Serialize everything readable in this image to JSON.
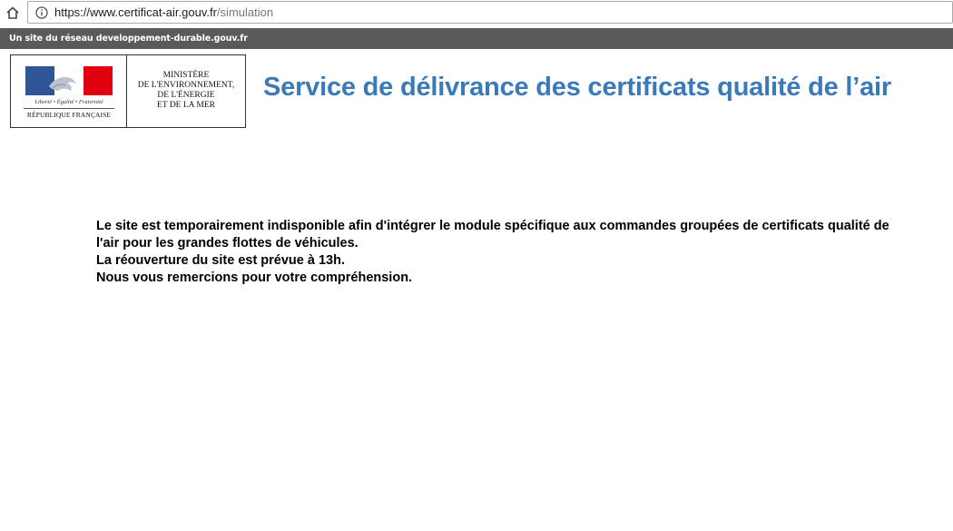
{
  "browser": {
    "url_host": "https://www.certificat-air.gouv.fr",
    "url_path": "/simulation"
  },
  "network_strip": {
    "text": "Un site du réseau developpement-durable.gouv.fr"
  },
  "logo": {
    "motto": "Liberté • Égalité • Fraternité",
    "republique": "RÉPUBLIQUE FRANÇAISE",
    "ministere_lines": [
      "MINISTÈRE",
      "DE L'ENVIRONNEMENT,",
      "DE L'ÉNERGIE",
      "ET DE LA MER"
    ]
  },
  "header": {
    "title": "Service de délivrance des certificats qualité de l’air"
  },
  "message": {
    "paragraph1": "Le site est temporairement indisponible afin d'intégrer le module spécifique aux commandes groupées de certificats qualité de l'air pour les grandes flottes de véhicules.",
    "line2": "La réouverture du site est prévue à 13h.",
    "line3": "Nous vous remercions pour votre compréhension."
  },
  "colors": {
    "title_blue": "#3a7ab9",
    "strip_gray": "#5a5a5a",
    "flag_blue": "#2f5597",
    "flag_red": "#e1000f"
  },
  "icons": {
    "home": "home-icon",
    "info": "info-icon"
  }
}
